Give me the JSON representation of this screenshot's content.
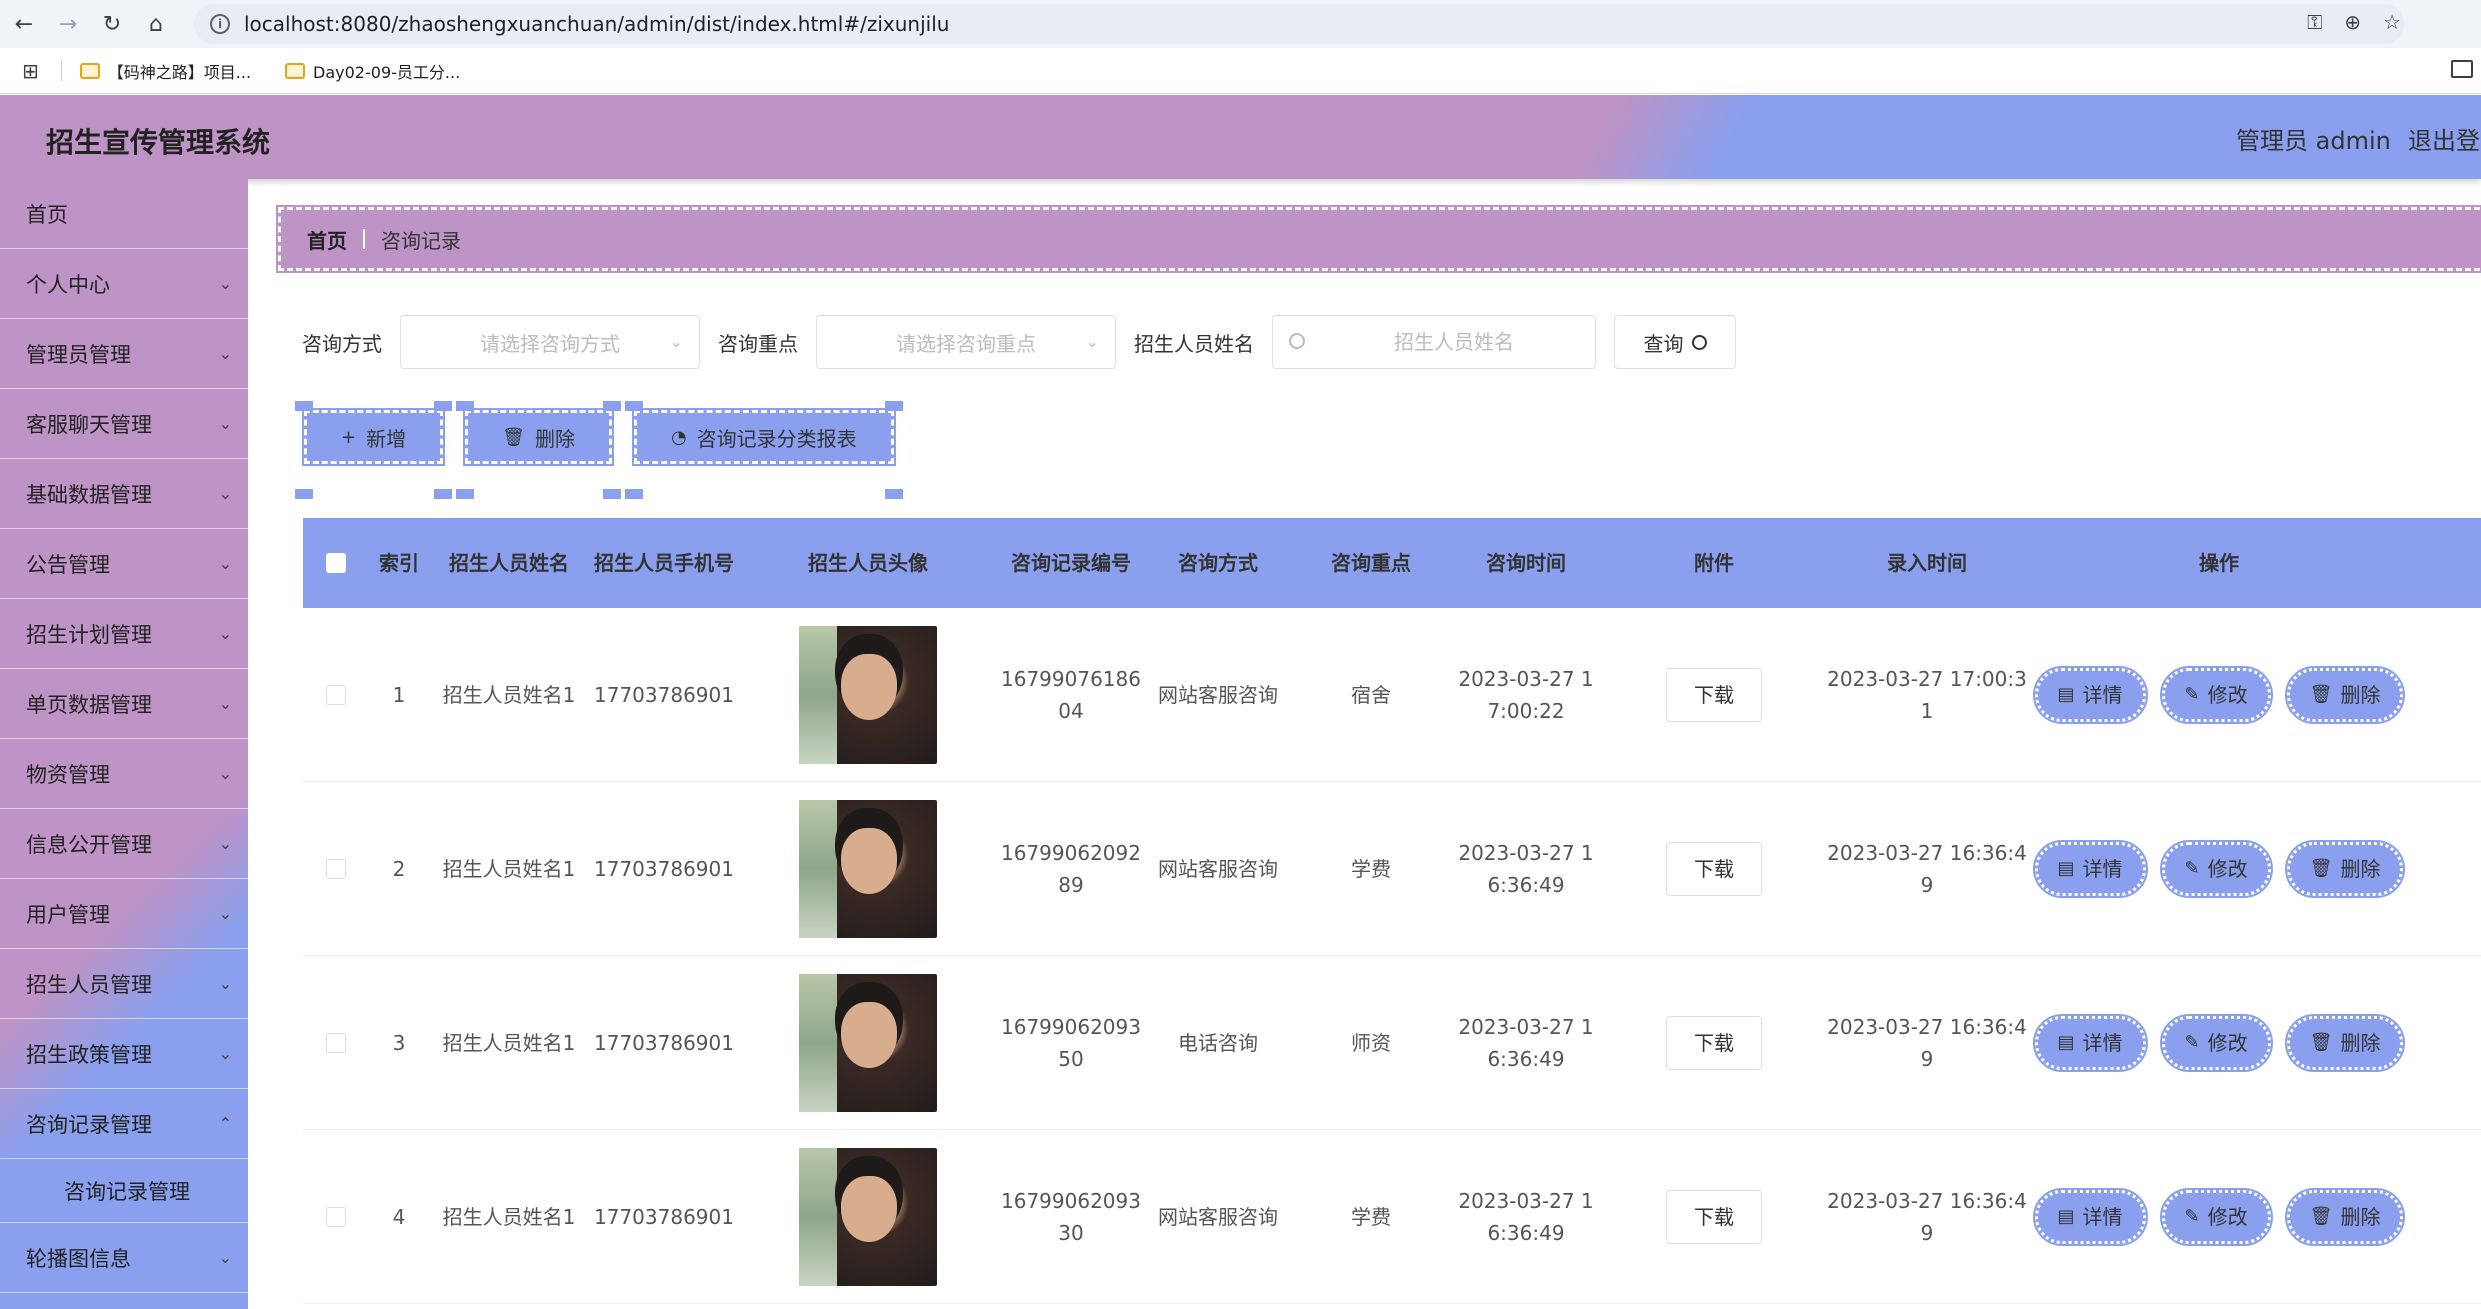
{
  "browser": {
    "url": "localhost:8080/zhaoshengxuanchuan/admin/dist/index.html#/zixunjilu",
    "bookmarks": [
      "【码神之路】项目...",
      "Day02-09-员工分..."
    ]
  },
  "header": {
    "title": "招生宣传管理系统",
    "user": "管理员 admin",
    "logout": "退出登录"
  },
  "sidebar": {
    "items": [
      {
        "label": "首页"
      },
      {
        "label": "个人中心"
      },
      {
        "label": "管理员管理"
      },
      {
        "label": "客服聊天管理"
      },
      {
        "label": "基础数据管理"
      },
      {
        "label": "公告管理"
      },
      {
        "label": "招生计划管理"
      },
      {
        "label": "单页数据管理"
      },
      {
        "label": "物资管理"
      },
      {
        "label": "信息公开管理"
      },
      {
        "label": "用户管理"
      },
      {
        "label": "招生人员管理"
      },
      {
        "label": "招生政策管理"
      },
      {
        "label": "咨询记录管理"
      }
    ],
    "sub_item": "咨询记录管理",
    "last_item": "轮播图信息"
  },
  "breadcrumb": {
    "home": "首页",
    "current": "咨询记录"
  },
  "search": {
    "way_label": "咨询方式",
    "way_placeholder": "请选择咨询方式",
    "focus_label": "咨询重点",
    "focus_placeholder": "请选择咨询重点",
    "name_label": "招生人员姓名",
    "name_placeholder": "招生人员姓名",
    "query_button": "查询"
  },
  "actions": {
    "add": "新增",
    "delete": "删除",
    "report": "咨询记录分类报表"
  },
  "table": {
    "headers": {
      "index": "索引",
      "name": "招生人员姓名",
      "phone": "招生人员手机号",
      "avatar": "招生人员头像",
      "record_no": "咨询记录编号",
      "way": "咨询方式",
      "focus": "咨询重点",
      "time": "咨询时间",
      "attachment": "附件",
      "entry_time": "录入时间",
      "ops": "操作"
    },
    "rows": [
      {
        "index": "1",
        "name": "招生人员姓名1",
        "phone": "17703786901",
        "record_no": "1679907618604",
        "way": "网站客服咨询",
        "focus": "宿舍",
        "time": "2023-03-27 17:00:22",
        "attachment": "下载",
        "entry_time": "2023-03-27 17:00:31"
      },
      {
        "index": "2",
        "name": "招生人员姓名1",
        "phone": "17703786901",
        "record_no": "1679906209289",
        "way": "网站客服咨询",
        "focus": "学费",
        "time": "2023-03-27 16:36:49",
        "attachment": "下载",
        "entry_time": "2023-03-27 16:36:49"
      },
      {
        "index": "3",
        "name": "招生人员姓名1",
        "phone": "17703786901",
        "record_no": "1679906209350",
        "way": "电话咨询",
        "focus": "师资",
        "time": "2023-03-27 16:36:49",
        "attachment": "下载",
        "entry_time": "2023-03-27 16:36:49"
      },
      {
        "index": "4",
        "name": "招生人员姓名1",
        "phone": "17703786901",
        "record_no": "1679906209330",
        "way": "网站客服咨询",
        "focus": "学费",
        "time": "2023-03-27 16:36:49",
        "attachment": "下载",
        "entry_time": "2023-03-27 16:36:49"
      }
    ],
    "row_ops": {
      "detail": "详情",
      "edit": "修改",
      "delete": "删除"
    }
  },
  "colors": {
    "purple": "#be93c5",
    "blue": "#8aa0ee"
  }
}
